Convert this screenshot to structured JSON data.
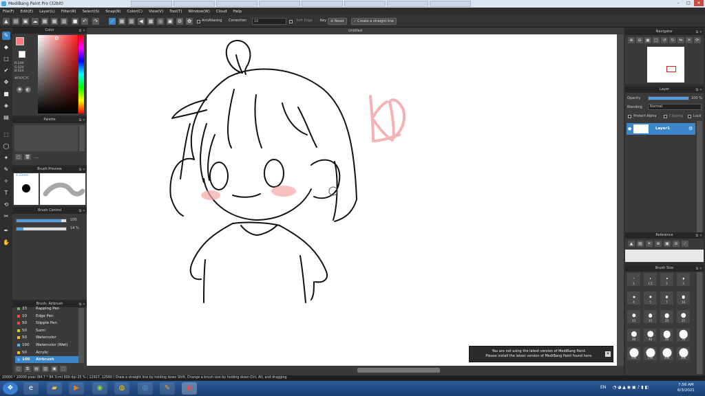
{
  "app": {
    "title": "MediBang Paint Pro (32bit)"
  },
  "menu": [
    "File(F)",
    "Edit(E)",
    "Layer(L)",
    "Filter(R)",
    "Select(S)",
    "Snap(N)",
    "Color(C)",
    "View(V)",
    "Tool(T)",
    "Window(W)",
    "Cloud",
    "Help"
  ],
  "toolbar": {
    "antialias_label": "AntiAliasing",
    "correction_label": "Correction",
    "correction_value": "10",
    "soft_edge_label": "Soft Edge",
    "key_label": "Key",
    "reset_label": "Reset",
    "straight_line_label": "Create a straight line"
  },
  "color_panel": {
    "title": "Color",
    "r": "R:249",
    "g": "G:124",
    "b": "B:124",
    "hex": "#F97C7C",
    "accent": "#F97C7C"
  },
  "palette_panel": {
    "title": "Palette"
  },
  "brush_preview_panel": {
    "title": "Brush Preview",
    "size": "4.23mm"
  },
  "brush_control_panel": {
    "title": "Brush Control",
    "size_value": "100",
    "opacity_value": "14 %",
    "size_fraction": 0.9,
    "opacity_fraction": 0.14
  },
  "brush_list_panel": {
    "title": "Brush: Airbrush",
    "items": [
      {
        "size": "33",
        "name": "Rapping Pen",
        "color": "#6ab04c"
      },
      {
        "size": "10",
        "name": "Edge Pen",
        "color": "#e84c3d"
      },
      {
        "size": "50",
        "name": "Stipple Pen",
        "color": "#e84c3d"
      },
      {
        "size": "50",
        "name": "Sumi",
        "color": "#f1c40f"
      },
      {
        "size": "50",
        "name": "Watercolor",
        "color": "#f1c40f"
      },
      {
        "size": "100",
        "name": "Watercolor (Wet)",
        "color": "#5dade2"
      },
      {
        "size": "50",
        "name": "Acrylic",
        "color": "#f1c40f"
      },
      {
        "size": "100",
        "name": "Airbrush",
        "color": "#5dade2"
      }
    ]
  },
  "canvas": {
    "doc_title": "Untitled"
  },
  "notification": {
    "line1": "You are not using the latest version of MediBang Paint.",
    "line2": "Please install the latest version of MediBang Paint found here."
  },
  "navigator_panel": {
    "title": "Navigator"
  },
  "layer_panel": {
    "title": "Layer",
    "opacity_label": "Opacity",
    "opacity_value": "100 %",
    "blending_label": "Blending",
    "blending_value": "Normal",
    "protect_alpha_label": "Protect Alpha",
    "clipping_label": "Clipping",
    "lock_label": "Lock",
    "layer_name": "Layer1"
  },
  "reference_panel": {
    "title": "Reference"
  },
  "brush_size_panel": {
    "title": "Brush Size",
    "sizes": [
      "1",
      "1.5",
      "2",
      "3",
      "4",
      "5",
      "7",
      "10",
      "13",
      "15",
      "20",
      "25",
      "30",
      "40",
      "50",
      "70",
      "100",
      "150",
      "200",
      "300"
    ]
  },
  "status_bar": {
    "text": "20000 * 20000 pixel   (84.7 * 84.7cm)   600 dpi   25 %   ( 12927, 12560 )   Draw a straight line by holding down Shift, Change a brush size by holding down Ctrl, Alt, and dragging"
  },
  "taskbar": {
    "lang": "EN",
    "time": "7:56 AM",
    "date": "6/3/2021"
  }
}
